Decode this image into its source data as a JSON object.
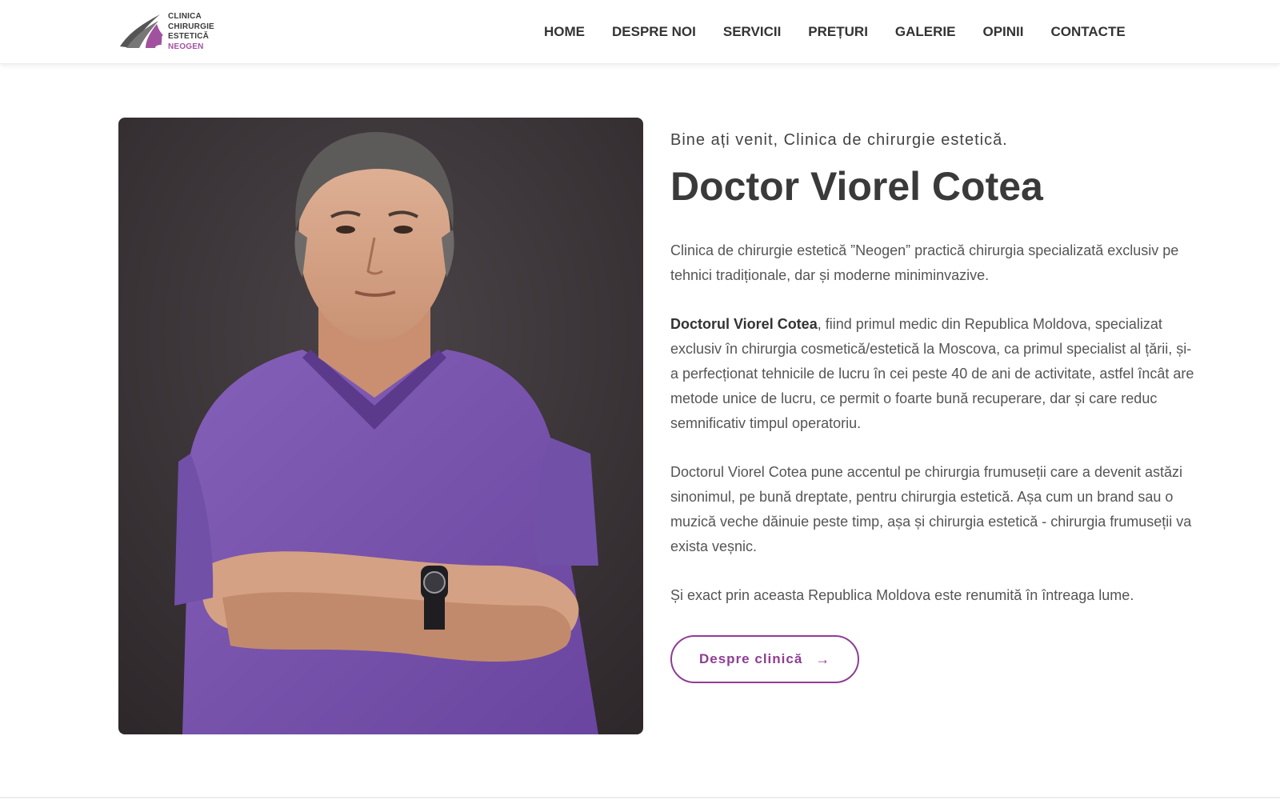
{
  "header": {
    "logo_lines": [
      "CLINICA",
      "CHIRURGIE",
      "ESTETICĂ",
      "NEOGEN"
    ],
    "nav": [
      "HOME",
      "DESPRE NOI",
      "SERVICII",
      "PREȚURI",
      "GALERIE",
      "OPINII",
      "CONTACTE"
    ]
  },
  "hero": {
    "photo_icon": "doctor-portrait",
    "subtitle": "Bine ați venit, Clinica de chirurgie estetică.",
    "title": "Doctor Viorel Cotea",
    "para1": "Clinica de chirurgie estetică ”Neogen” practică chirurgia specializată exclusiv pe tehnici tradiționale, dar și moderne miniminvazive.",
    "para2_bold": "Doctorul Viorel Cotea",
    "para2_rest": ", fiind primul medic din Republica Moldova, specializat exclusiv în chirurgia cosmetică/estetică la Moscova, ca primul specialist al țării, și-a perfecționat tehnicile de lucru în cei peste 40 de ani de activitate, astfel încât are metode unice de lucru, ce permit o foarte bună recuperare, dar și care reduc semnificativ timpul operatoriu.",
    "para3": "Doctorul Viorel Cotea pune accentul pe chirurgia frumuseții care a devenit astăzi sinonimul, pe bună dreptate, pentru chirurgia estetică. Așa cum un brand sau o muzică veche dăinuie peste timp, așa și chirurgia estetică - chirurgia frumuseții va exista veșnic.",
    "para4": "Și exact prin aceasta Republica Moldova este renumită în întreaga lume.",
    "cta_label": "Despre clinică",
    "cta_icon": "arrow-right-icon"
  },
  "colors": {
    "accent": "#8e3d94",
    "scrubs": "#7b54b0",
    "backdrop": "#3b3438"
  }
}
